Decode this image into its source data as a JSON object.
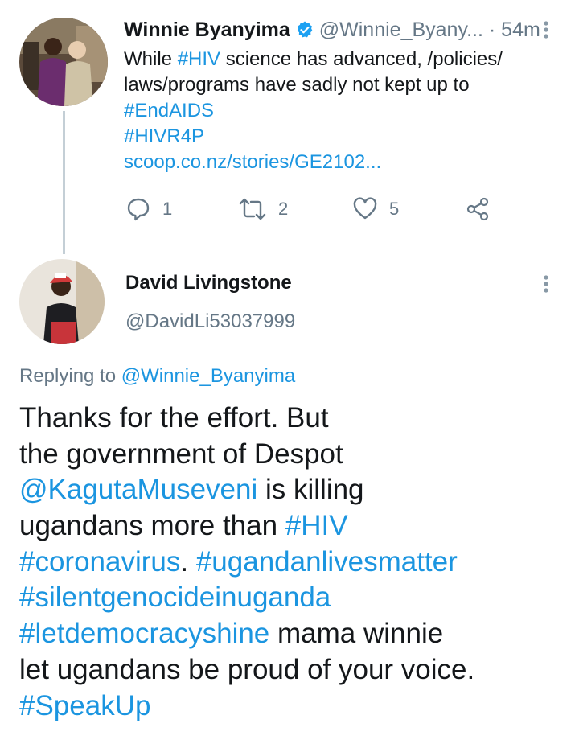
{
  "tweet": {
    "author_name": "Winnie Byanyima",
    "handle": "@Winnie_Byany...",
    "time_sep": " · ",
    "time": "54m",
    "body": {
      "l1_a": "While ",
      "l1_tag": "#HIV",
      "l1_b": " science has advanced, /policies/",
      "l2": "laws/programs have sadly not kept up to",
      "tag_endaids": "#EndAIDS",
      "tag_hivr4p": "#HIVR4P",
      "link": "scoop.co.nz/stories/GE2102..."
    },
    "actions": {
      "replies": "1",
      "retweets": "2",
      "likes": "5"
    }
  },
  "reply": {
    "author_name": "David Livingstone",
    "handle": "@DavidLi53037999",
    "replying_prefix": "Replying to ",
    "replying_to": "@Winnie_Byanyima",
    "body": {
      "l1": "Thanks for the effort. But",
      "l2": "the government of Despot",
      "l3_mention": "@KagutaMuseveni",
      "l3_rest": " is killing",
      "l4_text": "ugandans more than ",
      "l4_tag": "#HIV",
      "l5_tag1": "#coronavirus",
      "l5_dot": ". ",
      "l5_tag2": "#ugandanlivesmatter",
      "l6_tag": "#silentgenocideinuganda",
      "l7_tag": "#letdemocracyshine",
      "l7_rest": " mama winnie",
      "l8": "let ugandans be proud of your voice.",
      "l9_tag": "#SpeakUp"
    }
  },
  "colors": {
    "link": "#1b95e0",
    "muted": "#657786",
    "text": "#14171a",
    "thread_line": "#c4cfd6"
  }
}
